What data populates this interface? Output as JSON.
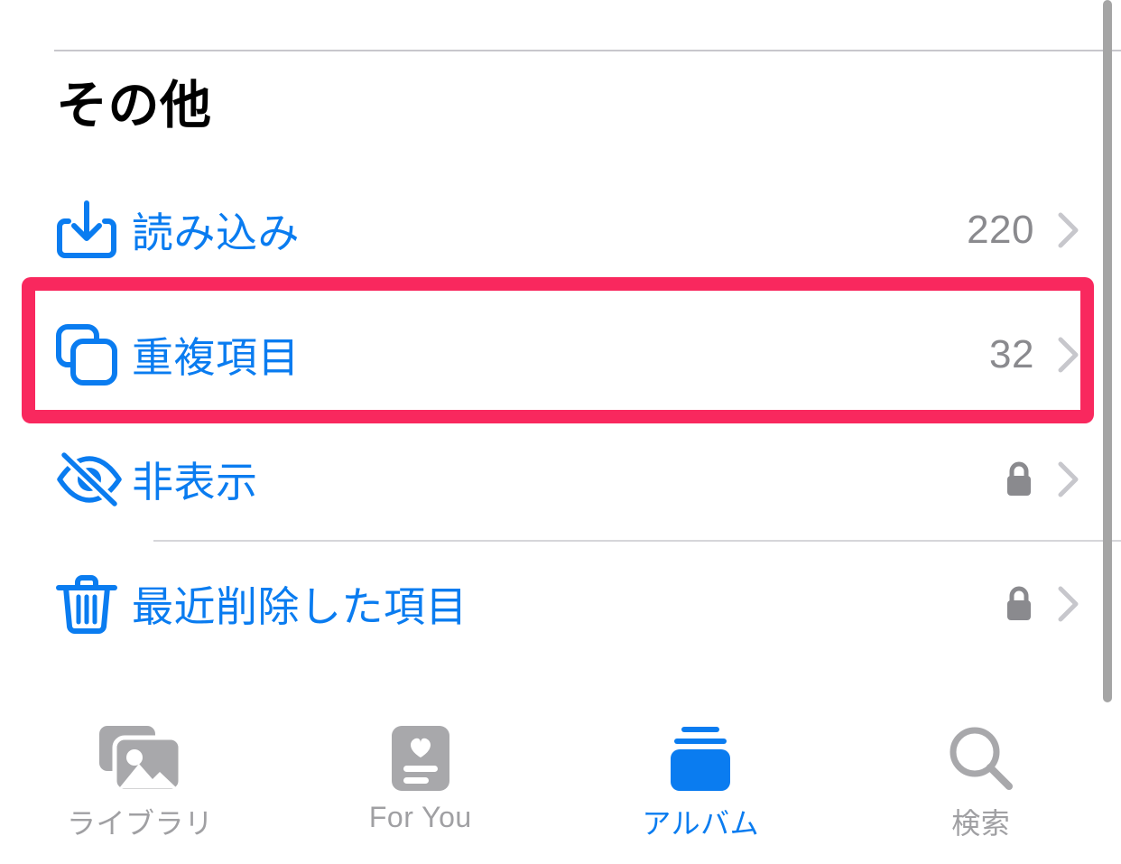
{
  "section": {
    "header": "その他"
  },
  "list": {
    "rows": [
      {
        "id": "import",
        "icon": "tray-arrow-down-icon",
        "label": "読み込み",
        "count": "220",
        "locked": false,
        "separator": false
      },
      {
        "id": "duplicates",
        "icon": "duplicate-squares-icon",
        "label": "重複項目",
        "count": "32",
        "locked": false,
        "separator": false,
        "highlighted": true
      },
      {
        "id": "hidden",
        "icon": "eye-slash-icon",
        "label": "非表示",
        "count": "",
        "locked": true,
        "separator": true
      },
      {
        "id": "recently-deleted",
        "icon": "trash-icon",
        "label": "最近削除した項目",
        "count": "",
        "locked": true,
        "separator": false
      }
    ]
  },
  "tabbar": {
    "tabs": [
      {
        "id": "library",
        "icon": "photo-stack-icon",
        "label": "ライブラリ",
        "active": false
      },
      {
        "id": "for-you",
        "icon": "memories-card-icon",
        "label": "For You",
        "active": false
      },
      {
        "id": "albums",
        "icon": "albums-stack-icon",
        "label": "アルバム",
        "active": true
      },
      {
        "id": "search",
        "icon": "magnifier-icon",
        "label": "検索",
        "active": false
      }
    ]
  },
  "colors": {
    "accent_blue": "#0A7CF0",
    "highlight_pink": "#F9285E",
    "count_gray": "#8A8A8E",
    "chevron_gray": "#C7C7CC",
    "tab_inactive_gray": "#A0A0A3",
    "separator_gray": "#D6D6DA",
    "scrollbar_gray": "#A5A5A5"
  },
  "scrollbar": {
    "position": "right",
    "visible": true
  }
}
